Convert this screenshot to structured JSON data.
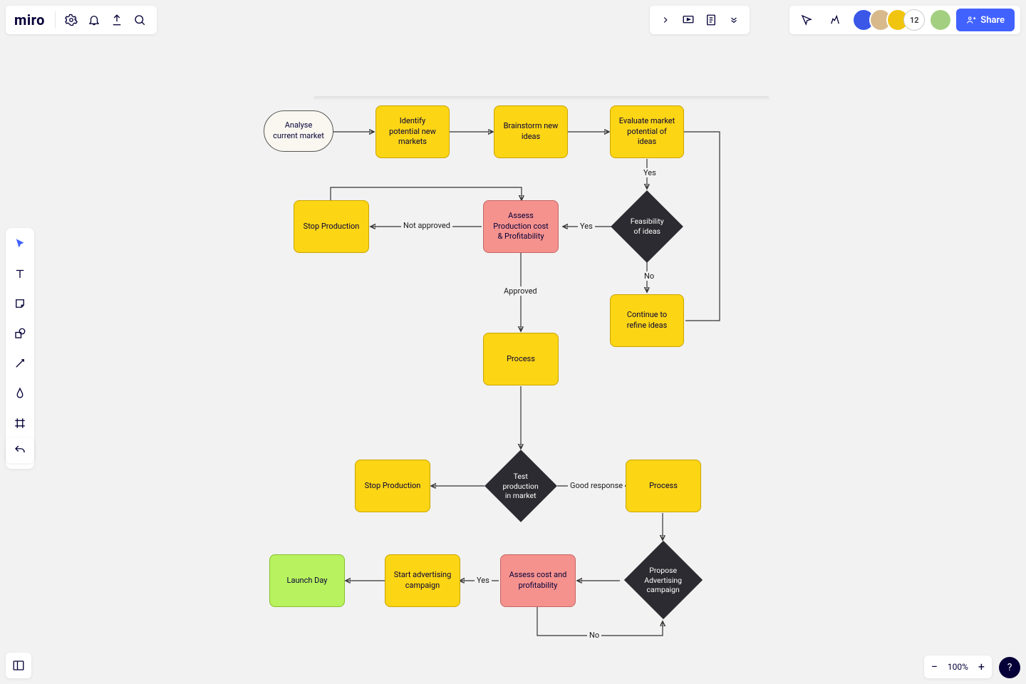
{
  "app": {
    "logo": "miro"
  },
  "toolbar_right": {
    "share": "Share",
    "overflow_count": "12"
  },
  "zoom": {
    "level": "100%",
    "help": "?"
  },
  "nodes": {
    "analyse": "Analyse current market",
    "identify": "Identify potential new markets",
    "brainstorm": "Brainstorm new ideas",
    "evaluate": "Evaluate market potential of ideas",
    "feasibility": "Feasibility of ideas",
    "refine": "Continue to refine ideas",
    "assess1": "Assess Production cost & Profitability",
    "stop1": "Stop Production",
    "process1": "Process",
    "test": "Test production in market",
    "stop2": "Stop Production",
    "process2": "Process",
    "propose": "Propose Advertising campaign",
    "assess2": "Assess cost and profitability",
    "startad": "Start advertising campaign",
    "launch": "Launch Day"
  },
  "labels": {
    "yes": "Yes",
    "no": "No",
    "approved": "Approved",
    "not_approved": "Not approved",
    "good_response": "Good response"
  }
}
